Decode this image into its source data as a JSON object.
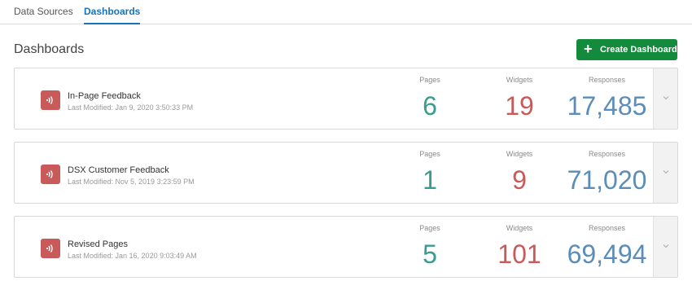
{
  "tabs": [
    {
      "label": "Data Sources",
      "active": false
    },
    {
      "label": "Dashboards",
      "active": true
    }
  ],
  "page": {
    "title": "Dashboards",
    "create_button": "Create Dashboard"
  },
  "metric_labels": {
    "pages": "Pages",
    "widgets": "Widgets",
    "responses": "Responses"
  },
  "dashboards": [
    {
      "name": "In-Page Feedback",
      "modified": "Last Modified: Jan 9, 2020 3:50:33 PM",
      "pages": "6",
      "widgets": "19",
      "responses": "17,485"
    },
    {
      "name": "DSX Customer Feedback",
      "modified": "Last Modified: Nov 5, 2019 3:23:59 PM",
      "pages": "1",
      "widgets": "9",
      "responses": "71,020"
    },
    {
      "name": "Revised Pages",
      "modified": "Last Modified: Jan 16, 2020 9:03:49 AM",
      "pages": "5",
      "widgets": "101",
      "responses": "69,494"
    }
  ],
  "colors": {
    "accent_blue": "#1a73b8",
    "create_green": "#138a3c",
    "icon_red": "#c85a5a",
    "pages_teal": "#3a9b8f",
    "widgets_red": "#c85a5a",
    "responses_blue": "#5b8db8"
  },
  "icons": {
    "dashboard_icon": "feedback-signal-icon",
    "expand_icon": "chevron-down-icon",
    "create_icon": "plus-icon"
  }
}
